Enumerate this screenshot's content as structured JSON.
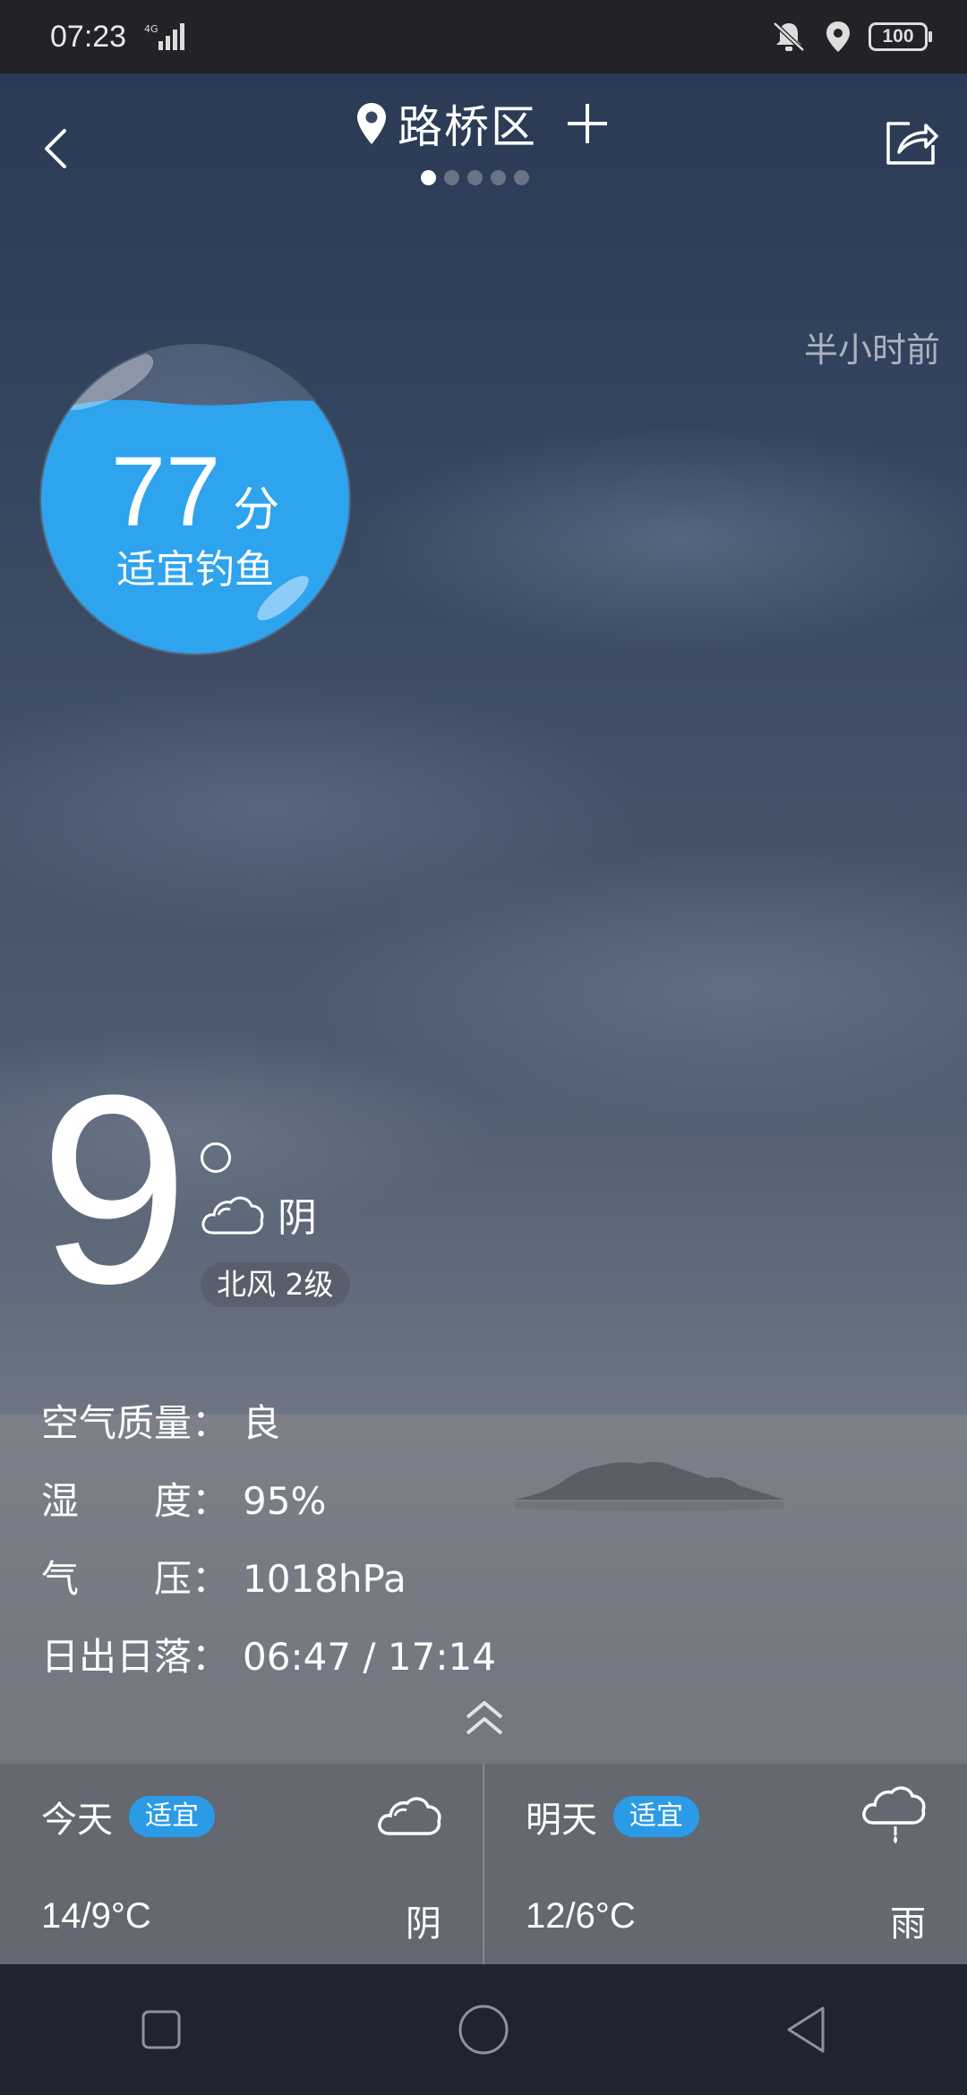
{
  "status_bar": {
    "time": "07:23",
    "network": "4G",
    "battery": "100",
    "icons": [
      "signal-icon",
      "mute-vibrate-icon",
      "location-icon",
      "battery-icon"
    ]
  },
  "header": {
    "location": "路桥区",
    "page_count": 5,
    "active_page": 1,
    "icons": [
      "back-icon",
      "location-pin-icon",
      "add-icon",
      "share-icon"
    ]
  },
  "updated": "半小时前",
  "fishing": {
    "score": "77",
    "unit": "分",
    "label": "适宜钓鱼",
    "accent": "#2ea3ee"
  },
  "current": {
    "temperature": "9",
    "condition": "阴",
    "wind": "北风 2级",
    "icon": "cloudy-icon"
  },
  "details": [
    {
      "label": "空气质量：",
      "value": "良"
    },
    {
      "label": "湿　　度：",
      "value": "95%"
    },
    {
      "label": "气　　压：",
      "value": "1018hPa"
    },
    {
      "label": "日出日落：",
      "value": "06:47 / 17:14"
    }
  ],
  "forecast": [
    {
      "day": "今天",
      "badge": "适宜",
      "range": "14/9°C",
      "condition": "阴",
      "icon": "cloudy-icon"
    },
    {
      "day": "明天",
      "badge": "适宜",
      "range": "12/6°C",
      "condition": "雨",
      "icon": "rain-icon"
    }
  ],
  "colors": {
    "badge": "#2c9be6",
    "statusbar": "#222326",
    "navbar": "#1f2430"
  },
  "nav": [
    "recents-square-icon",
    "home-circle-icon",
    "back-triangle-icon"
  ]
}
